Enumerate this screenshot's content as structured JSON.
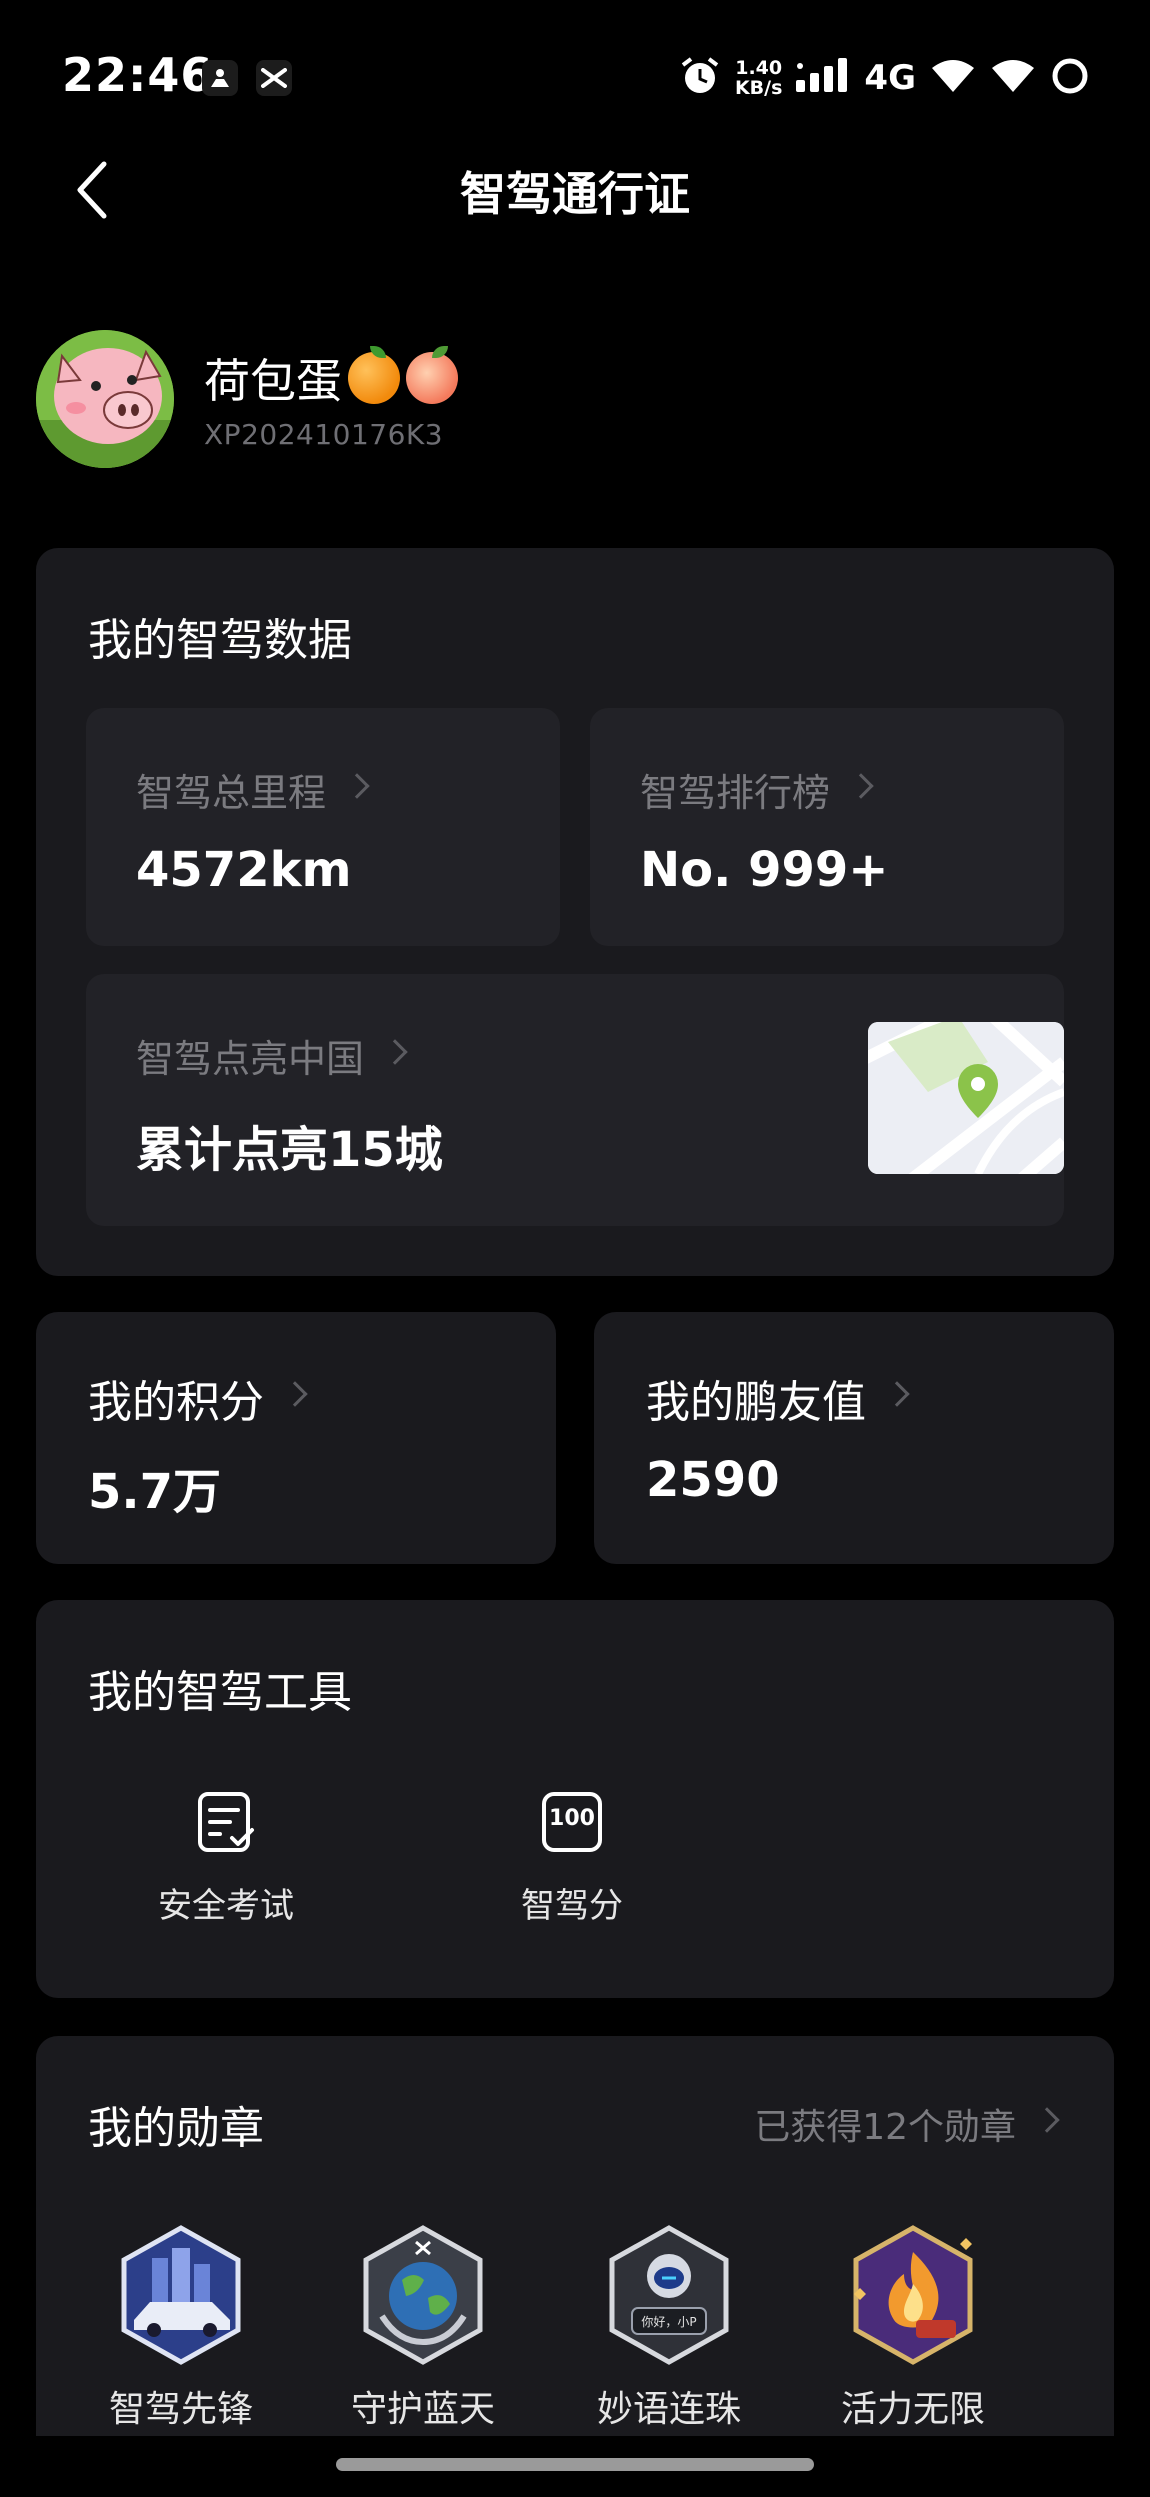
{
  "status_bar": {
    "time": "22:46",
    "speed_top": "1.40",
    "speed_bottom": "KB/s",
    "network": "4G",
    "icons": [
      "person-icon",
      "x-logo-icon",
      "alarm-icon",
      "signal-icon",
      "wifi-icon",
      "wifi-icon",
      "battery-ring-icon"
    ]
  },
  "nav": {
    "title": "智驾通行证"
  },
  "profile": {
    "name": "荷包蛋",
    "id": "XP202410176K3"
  },
  "data_section": {
    "title": "我的智驾数据",
    "mileage": {
      "label": "智驾总里程",
      "value": "4572km"
    },
    "ranking": {
      "label": "智驾排行榜",
      "value": "No. 999+"
    },
    "cities": {
      "label": "智驾点亮中国",
      "value": "累计点亮15城"
    }
  },
  "points": {
    "label": "我的积分",
    "value": "5.7万"
  },
  "friend_value": {
    "label": "我的鹏友值",
    "value": "2590"
  },
  "tools": {
    "title": "我的智驾工具",
    "items": [
      {
        "label": "安全考试",
        "icon": "checklist-icon"
      },
      {
        "label": "智驾分",
        "icon": "score-100-icon",
        "icon_text": "100"
      }
    ]
  },
  "badges": {
    "title": "我的勋章",
    "summary": "已获得12个勋章",
    "items": [
      {
        "label": "智驾先锋",
        "icon": "car-city-badge-icon"
      },
      {
        "label": "守护蓝天",
        "icon": "earth-badge-icon"
      },
      {
        "label": "妙语连珠",
        "icon": "astronaut-badge-icon",
        "icon_text": "你好，小P"
      },
      {
        "label": "活力无限",
        "icon": "flame-badge-icon"
      }
    ]
  },
  "colors": {
    "background": "#000000",
    "card": "#1a1a1e",
    "inner_card": "#222227",
    "muted_text": "#7b7b80",
    "map_pin": "#8bc34a"
  }
}
